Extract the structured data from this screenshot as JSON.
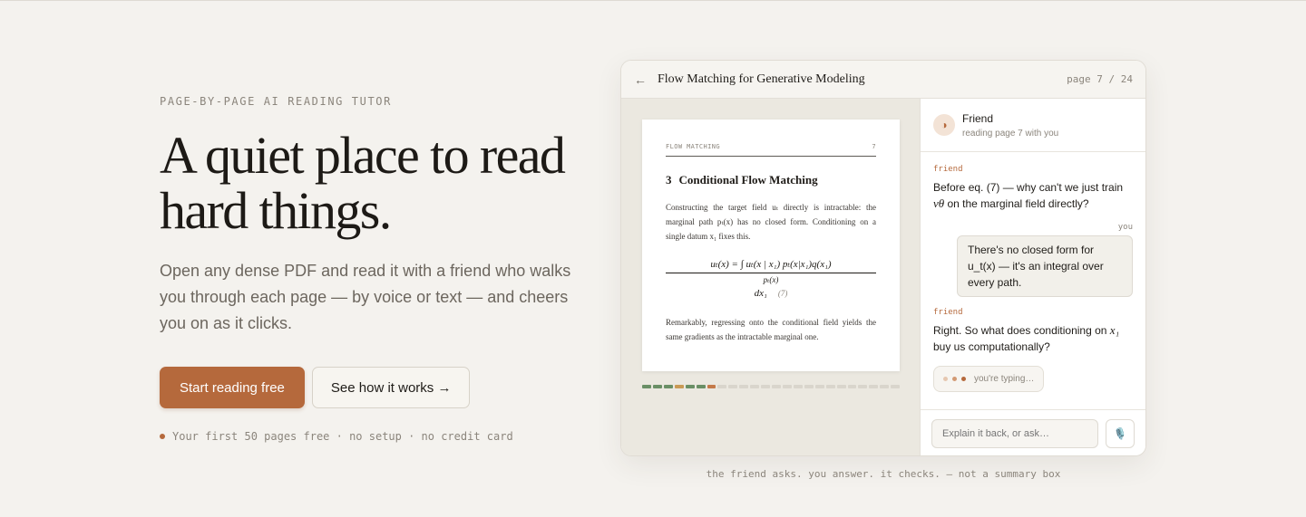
{
  "hero": {
    "eyebrow": "PAGE-BY-PAGE AI READING TUTOR",
    "headline_line1": "A quiet place to read",
    "headline_line2": "hard things.",
    "lede": "Open any dense PDF and read it with a friend who walks you through each page — by voice or text — and cheers you on as it clicks.",
    "primary_cta": "Start reading free",
    "secondary_cta": "See how it works →",
    "note": "Your first 50 pages free · no setup · no credit card"
  },
  "window": {
    "back_icon": "←",
    "doc_title": "Flow Matching for Generative Modeling",
    "page_indicator": "page 7 / 24"
  },
  "paper": {
    "running_head_left": "FLOW MATCHING",
    "running_head_right": "7",
    "section_num": "3",
    "section_title": "Conditional Flow Matching",
    "para1": "Constructing the target field uₜ directly is intractable: the marginal path pₜ(x) has no closed form. Conditioning on a single datum x₁ fixes this.",
    "eq_numerator": "uₜ(x) = ∫ uₜ(x | x₁) pₜ(x|x₁)q(x₁)",
    "eq_denominator": "pₜ(x)",
    "eq_tail": "dx₁",
    "eq_tag": "(7)",
    "para2": "Remarkably, regressing onto the conditional field yields the same gradients as the intractable marginal one."
  },
  "progress": {
    "total_pages": 24,
    "current_page": 7,
    "segments": [
      "done",
      "done",
      "done",
      "warn",
      "done",
      "done",
      "current",
      "todo",
      "todo",
      "todo",
      "todo",
      "todo",
      "todo",
      "todo",
      "todo",
      "todo",
      "todo",
      "todo",
      "todo",
      "todo",
      "todo",
      "todo",
      "todo",
      "todo"
    ]
  },
  "chat": {
    "avatar_icon": "◑",
    "friend_name": "Friend",
    "friend_status": "reading page 7 with you",
    "messages": [
      {
        "speaker": "friend",
        "text_before": "Before eq. (7) — why can't we just train ",
        "math": "vθ",
        "text_after": " on the marginal field directly?"
      },
      {
        "speaker": "you",
        "text": "There's no closed form for u_t(x) — it's an integral over every path."
      },
      {
        "speaker": "friend",
        "text_before": "Right. So what does conditioning on ",
        "math": "x₁",
        "text_after": " buy us computationally?"
      }
    ],
    "typing_label": "you're typing…",
    "composer_placeholder": "Explain it back, or ask…",
    "mic_icon": "🎙️"
  },
  "caption": "the friend asks. you answer. it checks. — not a summary box",
  "colors": {
    "background": "#f4f2ee",
    "accent": "#b5693c",
    "progress_done": "#6a8f66",
    "progress_warn": "#c99a55",
    "progress_current": "#c47a4a"
  }
}
